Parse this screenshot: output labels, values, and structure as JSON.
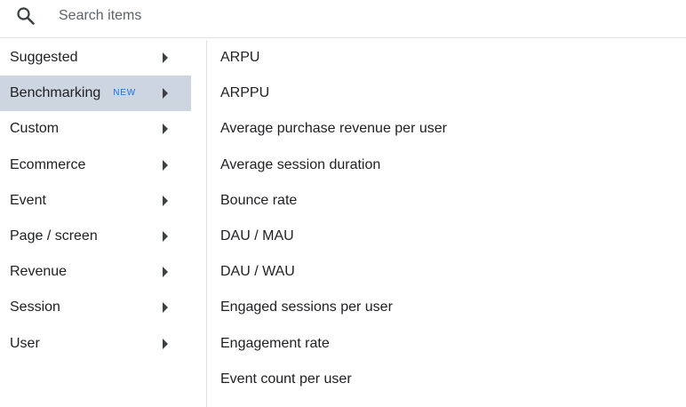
{
  "search": {
    "placeholder": "Search items",
    "value": ""
  },
  "categories": [
    {
      "label": "Suggested",
      "badge": "",
      "selected": false
    },
    {
      "label": "Benchmarking",
      "badge": "NEW",
      "selected": true
    },
    {
      "label": "Custom",
      "badge": "",
      "selected": false
    },
    {
      "label": "Ecommerce",
      "badge": "",
      "selected": false
    },
    {
      "label": "Event",
      "badge": "",
      "selected": false
    },
    {
      "label": "Page / screen",
      "badge": "",
      "selected": false
    },
    {
      "label": "Revenue",
      "badge": "",
      "selected": false
    },
    {
      "label": "Session",
      "badge": "",
      "selected": false
    },
    {
      "label": "User",
      "badge": "",
      "selected": false
    }
  ],
  "metrics": [
    "ARPU",
    "ARPPU",
    "Average purchase revenue per user",
    "Average session duration",
    "Bounce rate",
    "DAU / MAU",
    "DAU / WAU",
    "Engaged sessions per user",
    "Engagement rate",
    "Event count per user"
  ],
  "icons": {
    "search": "search-icon",
    "expand": "chevron-right-icon"
  },
  "colors": {
    "selected_background": "#cdd5e0",
    "badge": "#1a73e8",
    "divider": "#e0e0e0"
  }
}
